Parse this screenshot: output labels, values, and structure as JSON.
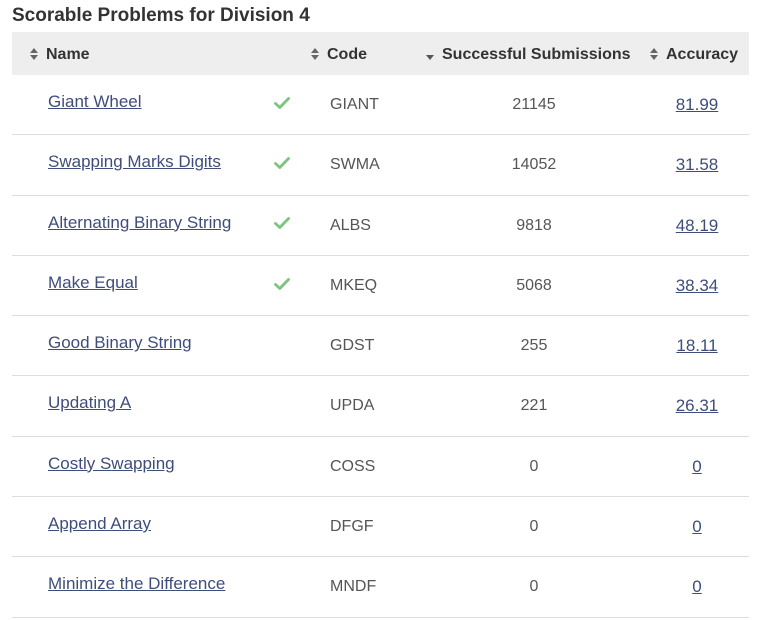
{
  "title": "Scorable Problems for Division 4",
  "columns": {
    "name": "Name",
    "code": "Code",
    "successful": "Successful Submissions",
    "accuracy": "Accuracy"
  },
  "icons": {
    "sort": "sort-icon",
    "sort_active": "sort-desc-icon",
    "solved": "check-icon"
  },
  "colors": {
    "link": "#3f4d7a",
    "check": "#7cc47f",
    "header_bg": "#eeeeee"
  },
  "rows": [
    {
      "name": "Giant Wheel",
      "solved": true,
      "code": "GIANT",
      "successful": "21145",
      "accuracy": "81.99"
    },
    {
      "name": "Swapping Marks Digits",
      "solved": true,
      "code": "SWMA",
      "successful": "14052",
      "accuracy": "31.58"
    },
    {
      "name": "Alternating Binary String",
      "solved": true,
      "code": "ALBS",
      "successful": "9818",
      "accuracy": "48.19"
    },
    {
      "name": "Make Equal",
      "solved": true,
      "code": "MKEQ",
      "successful": "5068",
      "accuracy": "38.34"
    },
    {
      "name": "Good Binary String",
      "solved": false,
      "code": "GDST",
      "successful": "255",
      "accuracy": "18.11"
    },
    {
      "name": "Updating A",
      "solved": false,
      "code": "UPDA",
      "successful": "221",
      "accuracy": "26.31"
    },
    {
      "name": "Costly Swapping",
      "solved": false,
      "code": "COSS",
      "successful": "0",
      "accuracy": "0"
    },
    {
      "name": "Append Array",
      "solved": false,
      "code": "DFGF",
      "successful": "0",
      "accuracy": "0"
    },
    {
      "name": "Minimize the Difference",
      "solved": false,
      "code": "MNDF",
      "successful": "0",
      "accuracy": "0"
    }
  ]
}
